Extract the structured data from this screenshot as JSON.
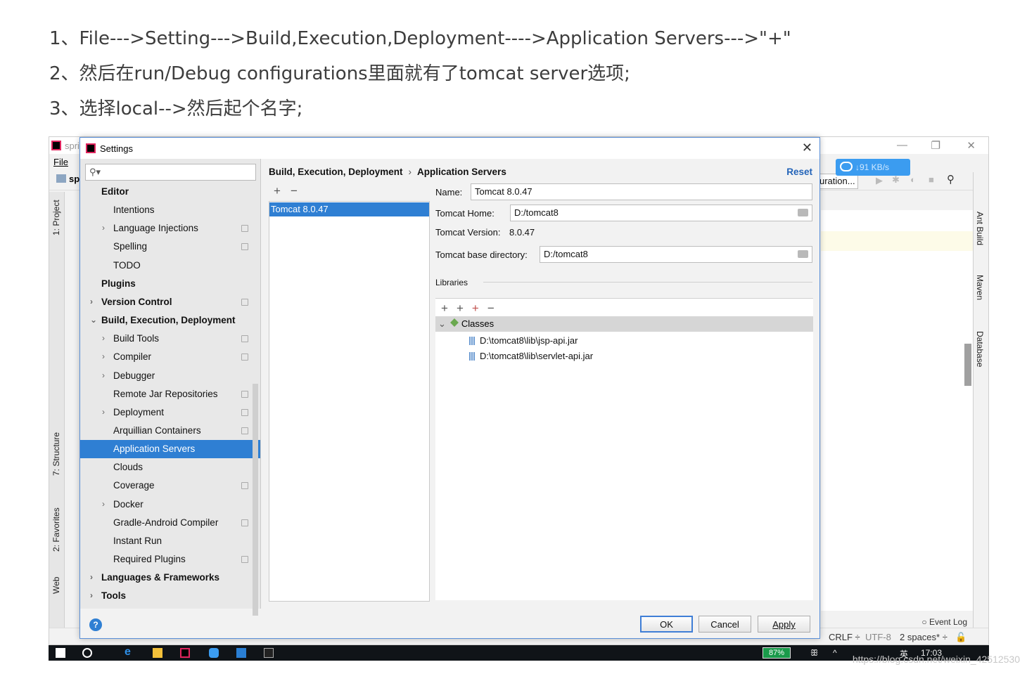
{
  "steps": [
    "1、File--->Setting--->Build,Execution,Deployment---->Application Servers--->\"+\"",
    "2、然后在run/Debug configurations里面就有了tomcat server选项;",
    "3、选择local-->然后起个名字;"
  ],
  "ide": {
    "title": "spri",
    "menu_file": "File",
    "project_short": "sp",
    "run_config": "uration...",
    "net_speed": "↓91 KB/s",
    "left_tabs": [
      "1: Project",
      "7: Structure",
      "2: Favorites",
      "Web"
    ],
    "right_tabs": [
      "Ant Build",
      "Maven",
      "Database"
    ],
    "event_log": "Event Log",
    "status": {
      "line_sep": "CRLF ÷",
      "encoding": "UTF-8",
      "indent": "2 spaces* ÷"
    }
  },
  "settings": {
    "title": "Settings",
    "search_placeholder": "",
    "tree": [
      {
        "label": "Editor",
        "bold": true,
        "level": 0,
        "arrow": ""
      },
      {
        "label": "Intentions",
        "bold": false,
        "level": 1,
        "arrow": ""
      },
      {
        "label": "Language Injections",
        "bold": false,
        "level": 1,
        "arrow": "›",
        "copy": true
      },
      {
        "label": "Spelling",
        "bold": false,
        "level": 1,
        "arrow": "",
        "copy": true
      },
      {
        "label": "TODO",
        "bold": false,
        "level": 1,
        "arrow": ""
      },
      {
        "label": "Plugins",
        "bold": true,
        "level": 0,
        "arrow": ""
      },
      {
        "label": "Version Control",
        "bold": true,
        "level": 0,
        "arrow": "›",
        "copy": true
      },
      {
        "label": "Build, Execution, Deployment",
        "bold": true,
        "level": 0,
        "arrow": "⌄"
      },
      {
        "label": "Build Tools",
        "bold": false,
        "level": 1,
        "arrow": "›",
        "copy": true
      },
      {
        "label": "Compiler",
        "bold": false,
        "level": 1,
        "arrow": "›",
        "copy": true
      },
      {
        "label": "Debugger",
        "bold": false,
        "level": 1,
        "arrow": "›"
      },
      {
        "label": "Remote Jar Repositories",
        "bold": false,
        "level": 1,
        "arrow": "",
        "copy": true
      },
      {
        "label": "Deployment",
        "bold": false,
        "level": 1,
        "arrow": "›",
        "copy": true
      },
      {
        "label": "Arquillian Containers",
        "bold": false,
        "level": 1,
        "arrow": "",
        "copy": true
      },
      {
        "label": "Application Servers",
        "bold": false,
        "level": 1,
        "arrow": "",
        "selected": true
      },
      {
        "label": "Clouds",
        "bold": false,
        "level": 1,
        "arrow": ""
      },
      {
        "label": "Coverage",
        "bold": false,
        "level": 1,
        "arrow": "",
        "copy": true
      },
      {
        "label": "Docker",
        "bold": false,
        "level": 1,
        "arrow": "›"
      },
      {
        "label": "Gradle-Android Compiler",
        "bold": false,
        "level": 1,
        "arrow": "",
        "copy": true
      },
      {
        "label": "Instant Run",
        "bold": false,
        "level": 1,
        "arrow": ""
      },
      {
        "label": "Required Plugins",
        "bold": false,
        "level": 1,
        "arrow": "",
        "copy": true
      },
      {
        "label": "Languages & Frameworks",
        "bold": true,
        "level": 0,
        "arrow": "›"
      },
      {
        "label": "Tools",
        "bold": true,
        "level": 0,
        "arrow": "›"
      }
    ],
    "breadcrumb": {
      "parent": "Build, Execution, Deployment",
      "sep": "›",
      "current": "Application Servers"
    },
    "reset_label": "Reset",
    "server_list": [
      "Tomcat 8.0.47"
    ],
    "form": {
      "name_label": "Name:",
      "name_value": "Tomcat 8.0.47",
      "home_label": "Tomcat Home:",
      "home_value": "D:/tomcat8",
      "version_label": "Tomcat Version:",
      "version_value": "8.0.47",
      "base_label": "Tomcat base directory:",
      "base_value": "D:/tomcat8",
      "libraries_label": "Libraries",
      "classes_label": "Classes",
      "jars": [
        "D:\\tomcat8\\lib\\jsp-api.jar",
        "D:\\tomcat8\\lib\\servlet-api.jar"
      ]
    },
    "buttons": {
      "ok": "OK",
      "cancel": "Cancel",
      "apply": "Apply"
    }
  },
  "taskbar": {
    "battery": "87%",
    "ime": "英",
    "time": "17:03"
  },
  "watermark": "https://blog.csdn.net/weixin_42512530"
}
